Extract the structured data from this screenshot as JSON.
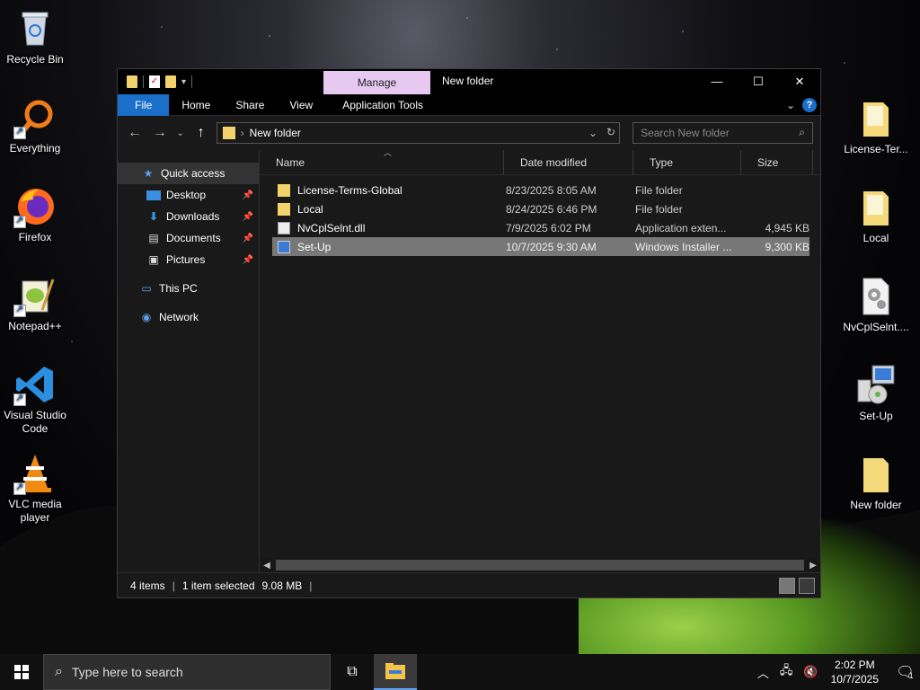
{
  "desktop": {
    "left_icons": [
      {
        "label": "Recycle Bin",
        "icon": "recycle-bin-icon"
      },
      {
        "label": "Everything",
        "icon": "everything-search-icon"
      },
      {
        "label": "Firefox",
        "icon": "firefox-icon"
      },
      {
        "label": "Notepad++",
        "icon": "notepad-plus-plus-icon"
      },
      {
        "label": "Visual Studio Code",
        "icon": "vscode-icon"
      },
      {
        "label": "VLC media player",
        "icon": "vlc-icon"
      }
    ],
    "right_icons": [
      {
        "label": "License-Ter...",
        "icon": "folder-icon"
      },
      {
        "label": "Local",
        "icon": "folder-icon"
      },
      {
        "label": "NvCplSelnt....",
        "icon": "dll-file-icon"
      },
      {
        "label": "Set-Up",
        "icon": "installer-icon"
      },
      {
        "label": "New folder",
        "icon": "folder-icon"
      }
    ]
  },
  "window": {
    "title": "New folder",
    "context_tab": "Manage",
    "ribbon_tabs": {
      "file": "File",
      "home": "Home",
      "share": "Share",
      "view": "View",
      "app_tools": "Application Tools"
    },
    "address": {
      "path": "New folder"
    },
    "search": {
      "placeholder": "Search New folder"
    },
    "nav": {
      "quick_access": "Quick access",
      "desktop": "Desktop",
      "downloads": "Downloads",
      "documents": "Documents",
      "pictures": "Pictures",
      "this_pc": "This PC",
      "network": "Network"
    },
    "columns": {
      "name": "Name",
      "date": "Date modified",
      "type": "Type",
      "size": "Size"
    },
    "files": [
      {
        "name": "License-Terms-Global",
        "date": "8/23/2025 8:05 AM",
        "type": "File folder",
        "size": "",
        "icon": "folder-icon"
      },
      {
        "name": "Local",
        "date": "8/24/2025 6:46 PM",
        "type": "File folder",
        "size": "",
        "icon": "folder-icon"
      },
      {
        "name": "NvCplSelnt.dll",
        "date": "7/9/2025 6:02 PM",
        "type": "Application exten...",
        "size": "4,945 KB",
        "icon": "dll-file-icon"
      },
      {
        "name": "Set-Up",
        "date": "10/7/2025 9:30 AM",
        "type": "Windows Installer ...",
        "size": "9,300 KB",
        "icon": "installer-icon"
      }
    ],
    "status": {
      "items": "4 items",
      "selected": "1 item selected",
      "size": "9.08 MB"
    }
  },
  "taskbar": {
    "search_placeholder": "Type here to search",
    "time": "2:02 PM",
    "date": "10/7/2025",
    "notification_count": "1"
  },
  "colors": {
    "accent": "#1a6fc9",
    "manage_tab": "#e6c8f0",
    "folder": "#f3d16b"
  }
}
